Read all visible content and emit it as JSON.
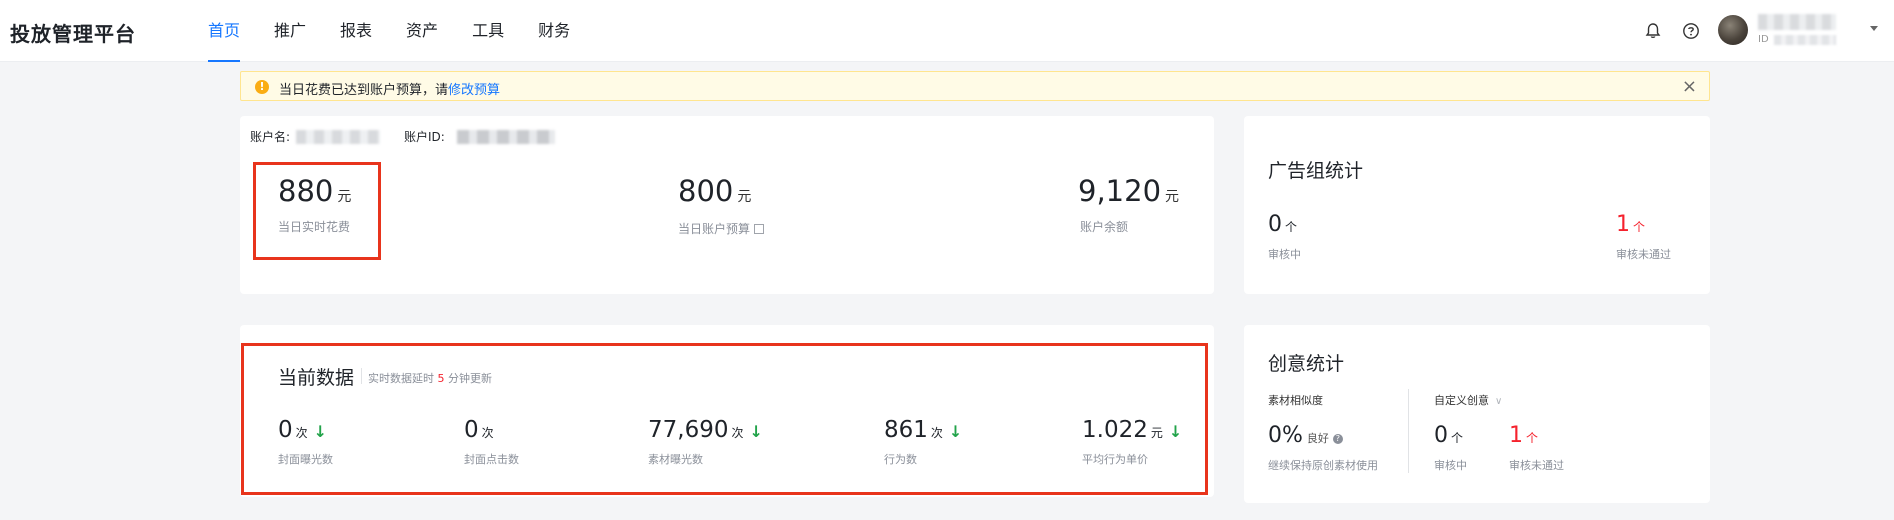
{
  "app": {
    "brand": "投放管理平台"
  },
  "nav": {
    "items": [
      {
        "label": "首页",
        "active": true
      },
      {
        "label": "推广",
        "active": false
      },
      {
        "label": "报表",
        "active": false
      },
      {
        "label": "资产",
        "active": false
      },
      {
        "label": "工具",
        "active": false
      },
      {
        "label": "财务",
        "active": false
      }
    ]
  },
  "user": {
    "id_prefix": "ID"
  },
  "notice": {
    "text": "当日花费已达到账户预算，请",
    "link": "修改预算",
    "close": "×"
  },
  "account": {
    "name_label": "账户名:",
    "id_label": "账户ID:",
    "spend": {
      "value": "880",
      "unit": "元",
      "label": "当日实时花费"
    },
    "budget": {
      "value": "800",
      "unit": "元",
      "label": "当日账户预算"
    },
    "balance": {
      "value": "9,120",
      "unit": "元",
      "label": "账户余额"
    }
  },
  "ad_group_stats": {
    "title": "广告组统计",
    "reviewing": {
      "value": "0",
      "unit": "个",
      "label": "审核中"
    },
    "rejected": {
      "value": "1",
      "unit": "个",
      "label": "审核未通过"
    }
  },
  "current_data": {
    "title": "当前数据",
    "note_prefix": "实时数据延时",
    "note_value": "5",
    "note_suffix": "分钟更新",
    "metrics": [
      {
        "value": "0",
        "unit": "次",
        "label": "封面曝光数",
        "trend": "down"
      },
      {
        "value": "0",
        "unit": "次",
        "label": "封面点击数",
        "trend": ""
      },
      {
        "value": "77,690",
        "unit": "次",
        "label": "素材曝光数",
        "trend": "down"
      },
      {
        "value": "861",
        "unit": "次",
        "label": "行为数",
        "trend": "down"
      },
      {
        "value": "1.022",
        "unit": "元",
        "label": "平均行为单价",
        "trend": "down"
      }
    ],
    "arrow_glyph": "↓"
  },
  "creative_stats": {
    "title": "创意统计",
    "similarity_label": "素材相似度",
    "similarity_value": "0%",
    "similarity_grade": "良好",
    "similarity_tip": "继续保持原创素材使用",
    "custom_label": "自定义创意",
    "reviewing": {
      "value": "0",
      "unit": "个",
      "label": "审核中"
    },
    "rejected": {
      "value": "1",
      "unit": "个",
      "label": "审核未通过"
    }
  },
  "colors": {
    "accent": "#1677ff",
    "danger": "#f5222d",
    "success": "#22a34a",
    "highlight_box": "#e8341c",
    "warning_bg": "#fffbe6"
  },
  "icons": [
    "bell-icon",
    "help-icon",
    "avatar",
    "caret-down-icon",
    "warning-icon",
    "close-icon",
    "edit-icon",
    "arrow-down-icon",
    "question-icon",
    "chevron-down-icon"
  ]
}
